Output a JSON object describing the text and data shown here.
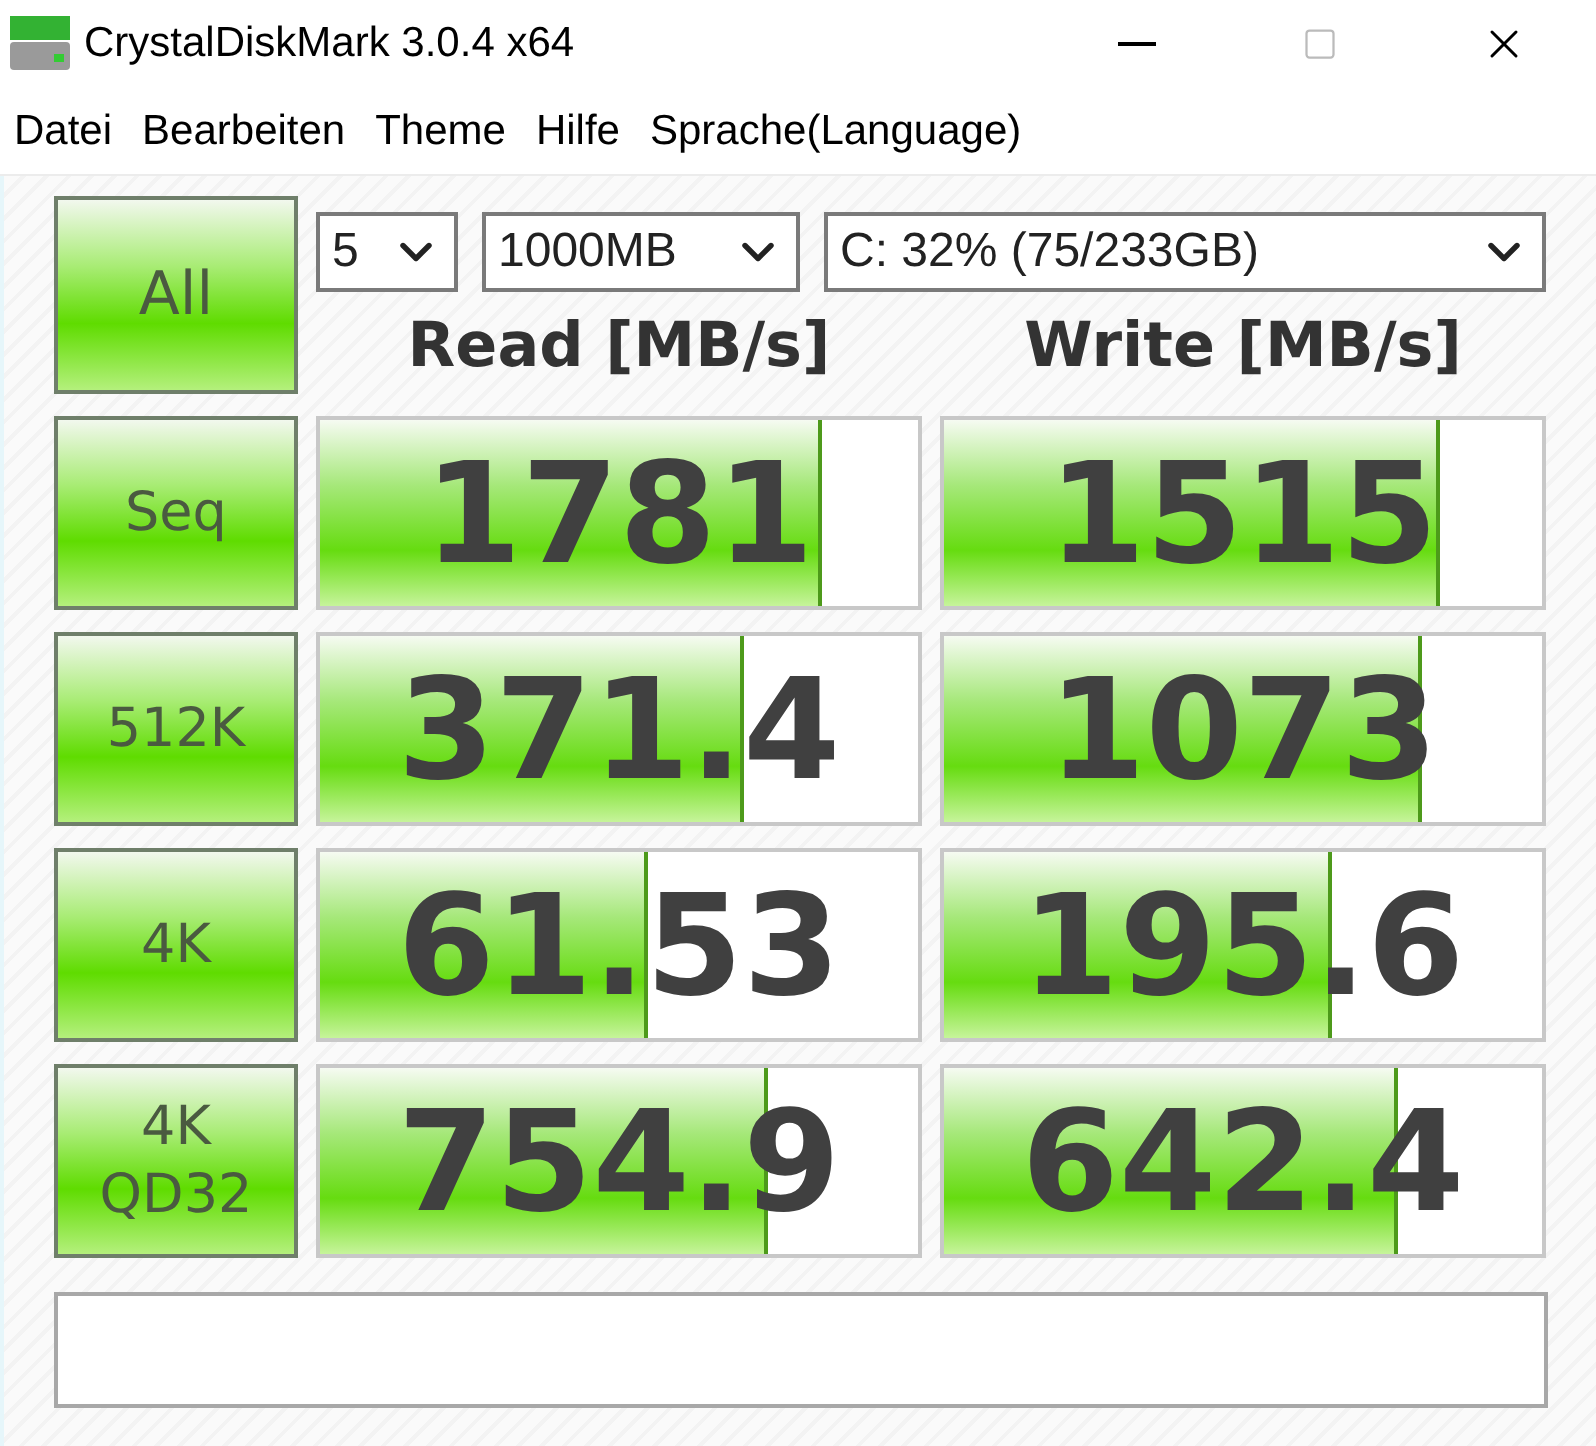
{
  "window": {
    "title": "CrystalDiskMark 3.0.4 x64"
  },
  "menu": [
    "Datei",
    "Bearbeiten",
    "Theme",
    "Hilfe",
    "Sprache(Language)"
  ],
  "all_button": "All",
  "selects": [
    {
      "value": "5"
    },
    {
      "value": "1000MB"
    },
    {
      "value": "C: 32% (75/233GB)"
    }
  ],
  "headers": [
    "Read [MB/s]",
    "Write [MB/s]"
  ],
  "rows": [
    {
      "label": "Seq",
      "read": {
        "value": "1781",
        "level": 0.84
      },
      "write": {
        "value": "1515",
        "level": 0.83
      }
    },
    {
      "label": "512K",
      "read": {
        "value": "371.4",
        "level": 0.71
      },
      "write": {
        "value": "1073",
        "level": 0.8
      }
    },
    {
      "label": "4K",
      "read": {
        "value": "61.53",
        "level": 0.55
      },
      "write": {
        "value": "195.6",
        "level": 0.65
      }
    },
    {
      "label": "4K\nQD32",
      "read": {
        "value": "754.9",
        "level": 0.75
      },
      "write": {
        "value": "642.4",
        "level": 0.76
      }
    }
  ]
}
